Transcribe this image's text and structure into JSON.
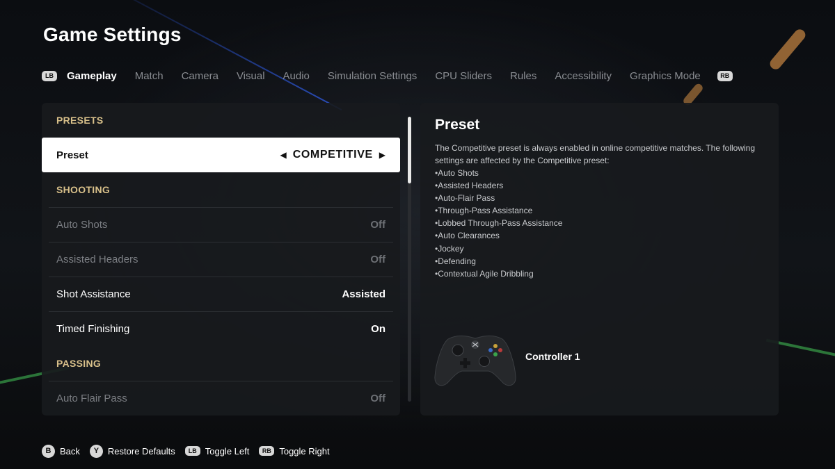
{
  "page": {
    "title": "Game Settings"
  },
  "tabs": {
    "left_bumper": "LB",
    "right_bumper": "RB",
    "items": [
      {
        "label": "Gameplay",
        "active": true
      },
      {
        "label": "Match"
      },
      {
        "label": "Camera"
      },
      {
        "label": "Visual"
      },
      {
        "label": "Audio"
      },
      {
        "label": "Simulation Settings"
      },
      {
        "label": "CPU Sliders"
      },
      {
        "label": "Rules"
      },
      {
        "label": "Accessibility"
      },
      {
        "label": "Graphics Mode"
      }
    ]
  },
  "settings": {
    "presets_header": "PRESETS",
    "preset": {
      "label": "Preset",
      "value": "COMPETITIVE",
      "left_arrow": "◀",
      "right_arrow": "▶"
    },
    "shooting_header": "SHOOTING",
    "auto_shots": {
      "label": "Auto Shots",
      "value": "Off",
      "disabled": true
    },
    "assisted_headers": {
      "label": "Assisted Headers",
      "value": "Off",
      "disabled": true
    },
    "shot_assistance": {
      "label": "Shot Assistance",
      "value": "Assisted"
    },
    "timed_finishing": {
      "label": "Timed Finishing",
      "value": "On"
    },
    "passing_header": "PASSING",
    "auto_flair_pass": {
      "label": "Auto Flair Pass",
      "value": "Off",
      "disabled": true
    }
  },
  "scroll": {
    "position_fraction": 0.0
  },
  "info": {
    "title": "Preset",
    "description": "The Competitive preset is always enabled in online competitive matches. The following settings are affected by the Competitive preset:",
    "bullets": [
      "Auto Shots",
      "Assisted Headers",
      "Auto-Flair Pass",
      "Through-Pass Assistance",
      "Lobbed Through-Pass Assistance",
      "Auto Clearances",
      "Jockey",
      "Defending",
      "Contextual Agile Dribbling"
    ],
    "controller_label": "Controller 1"
  },
  "footer": {
    "back": {
      "button": "B",
      "label": "Back"
    },
    "restore": {
      "button": "Y",
      "label": "Restore Defaults"
    },
    "toggle_left": {
      "button": "LB",
      "label": "Toggle Left"
    },
    "toggle_right": {
      "button": "RB",
      "label": "Toggle Right"
    }
  },
  "colors": {
    "section_header": "#d8c08a",
    "panel_bg": "#181a1d",
    "selected_row_bg": "#ffffff",
    "inactive_tab": "#8a8d92",
    "accent_blue_stripe": "#3264ff",
    "accent_green_stripe": "#46c85a"
  }
}
